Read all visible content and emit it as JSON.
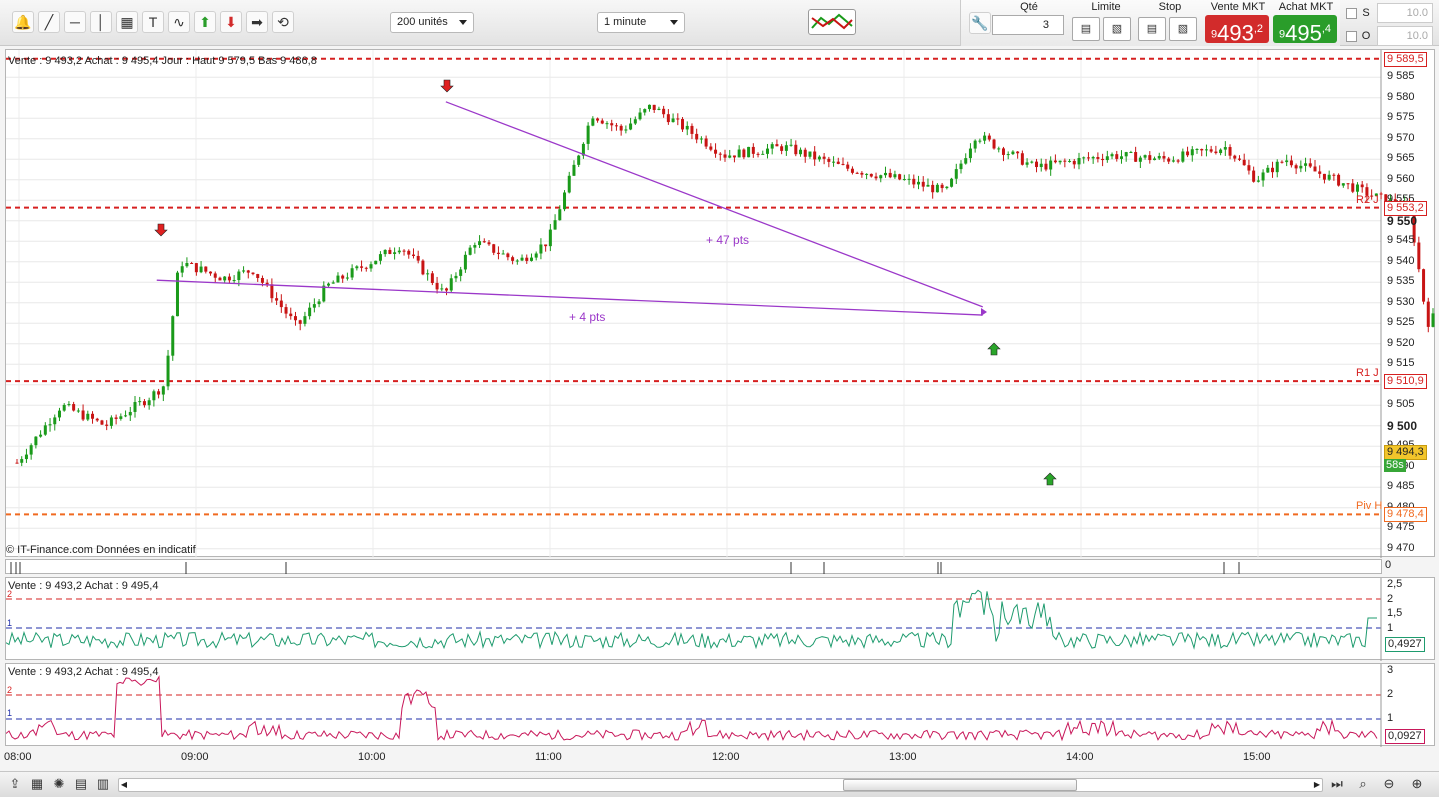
{
  "toolbar": {
    "tools": [
      {
        "name": "alerts-icon",
        "glyph": "🔔"
      },
      {
        "name": "trendline-tool-icon",
        "glyph": "╱"
      },
      {
        "name": "horizontal-line-tool-icon",
        "glyph": "─"
      },
      {
        "name": "vertical-line-tool-icon",
        "glyph": "│"
      },
      {
        "name": "fibonacci-tool-icon",
        "glyph": "▦"
      },
      {
        "name": "text-tool-icon",
        "glyph": "T"
      },
      {
        "name": "indicator-tool-icon",
        "glyph": "∿"
      },
      {
        "name": "buy-arrow-tool-icon",
        "glyph": "⬆"
      },
      {
        "name": "sell-arrow-tool-icon",
        "glyph": "⬇"
      },
      {
        "name": "exit-arrow-tool-icon",
        "glyph": "➡"
      },
      {
        "name": "loop-tool-icon",
        "glyph": "⟲"
      }
    ],
    "units_select": "200 unités",
    "timeframe_select": "1 minute"
  },
  "order": {
    "qty_label": "Qté",
    "qty_value": "3",
    "limit_label": "Limite",
    "stop_label": "Stop",
    "sell_label": "Vente MKT",
    "buy_label": "Achat MKT",
    "sell_small": "9",
    "sell_big": "493",
    "sell_sup": ",2",
    "buy_small": "9",
    "buy_big": "495",
    "buy_sup": ",4",
    "s_label": "S",
    "o_label": "O",
    "s_value": "10.0",
    "o_value": "10.0"
  },
  "main_panel": {
    "header": "Vente : 9 493,2 Achat : 9 495,4 Jour : Haut 9 579,5 Bas 9 486,8",
    "watermark": "© IT-Finance.com  Données en indicatif",
    "y_ticks": [
      "9 585",
      "9 580",
      "9 575",
      "9 570",
      "9 565",
      "9 560",
      "9 555",
      "9 550",
      "9 545",
      "9 540",
      "9 535",
      "9 530",
      "9 525",
      "9 520",
      "9 515",
      "9 510",
      "9 505",
      "9 500",
      "9 495",
      "9 490",
      "9 485",
      "9 480",
      "9 475",
      "9 470"
    ],
    "y_ticks_bold": [
      "9 550",
      "9 500"
    ],
    "levels": [
      {
        "label": "",
        "value_tag": "9 589,5",
        "price": 9589.5,
        "color": "#d62020"
      },
      {
        "label": "R2 J",
        "value_tag": "9 553,2",
        "price": 9553.2,
        "color": "#d62020"
      },
      {
        "label": "R1 J",
        "value_tag": "9 510,9",
        "price": 9510.9,
        "color": "#d62020"
      },
      {
        "label": "Piv H",
        "value_tag": "9 478,4",
        "price": 9478.4,
        "color": "#f06a20"
      }
    ],
    "last_price_tag": "9 494,3",
    "countdown_tag": "58s",
    "annotations": [
      {
        "text": "+ 47 pts"
      },
      {
        "text": "+ 4 pts"
      }
    ],
    "trades": [
      {
        "from": [
          9535.5,
          "08:45"
        ],
        "to": [
          9527,
          "13:25"
        ]
      },
      {
        "from": [
          9579,
          "10:23"
        ],
        "to": [
          9529,
          "13:25"
        ]
      }
    ]
  },
  "strip": {
    "right_tag": "0"
  },
  "ind1": {
    "header": "Vente : 9 493,2 Achat : 9 495,4",
    "level_labels": [
      "2",
      "1"
    ],
    "y_ticks": [
      "2,5",
      "2",
      "1,5",
      "1"
    ],
    "value_tag": "0,4927"
  },
  "ind2": {
    "header": "Vente : 9 493,2 Achat : 9 495,4",
    "level_labels": [
      "2",
      "1"
    ],
    "y_ticks": [
      "3",
      "2",
      "1"
    ],
    "value_tag": "0,0927"
  },
  "time_axis": [
    "08:00",
    "09:00",
    "10:00",
    "11:00",
    "12:00",
    "13:00",
    "14:00",
    "15:00"
  ],
  "colors": {
    "up": "#1a9a1a",
    "down": "#c81414",
    "trade": "#9b38c9",
    "ind1": "#1e9b6e",
    "ind2": "#c8185a",
    "blue": "#1f2ea8"
  }
}
